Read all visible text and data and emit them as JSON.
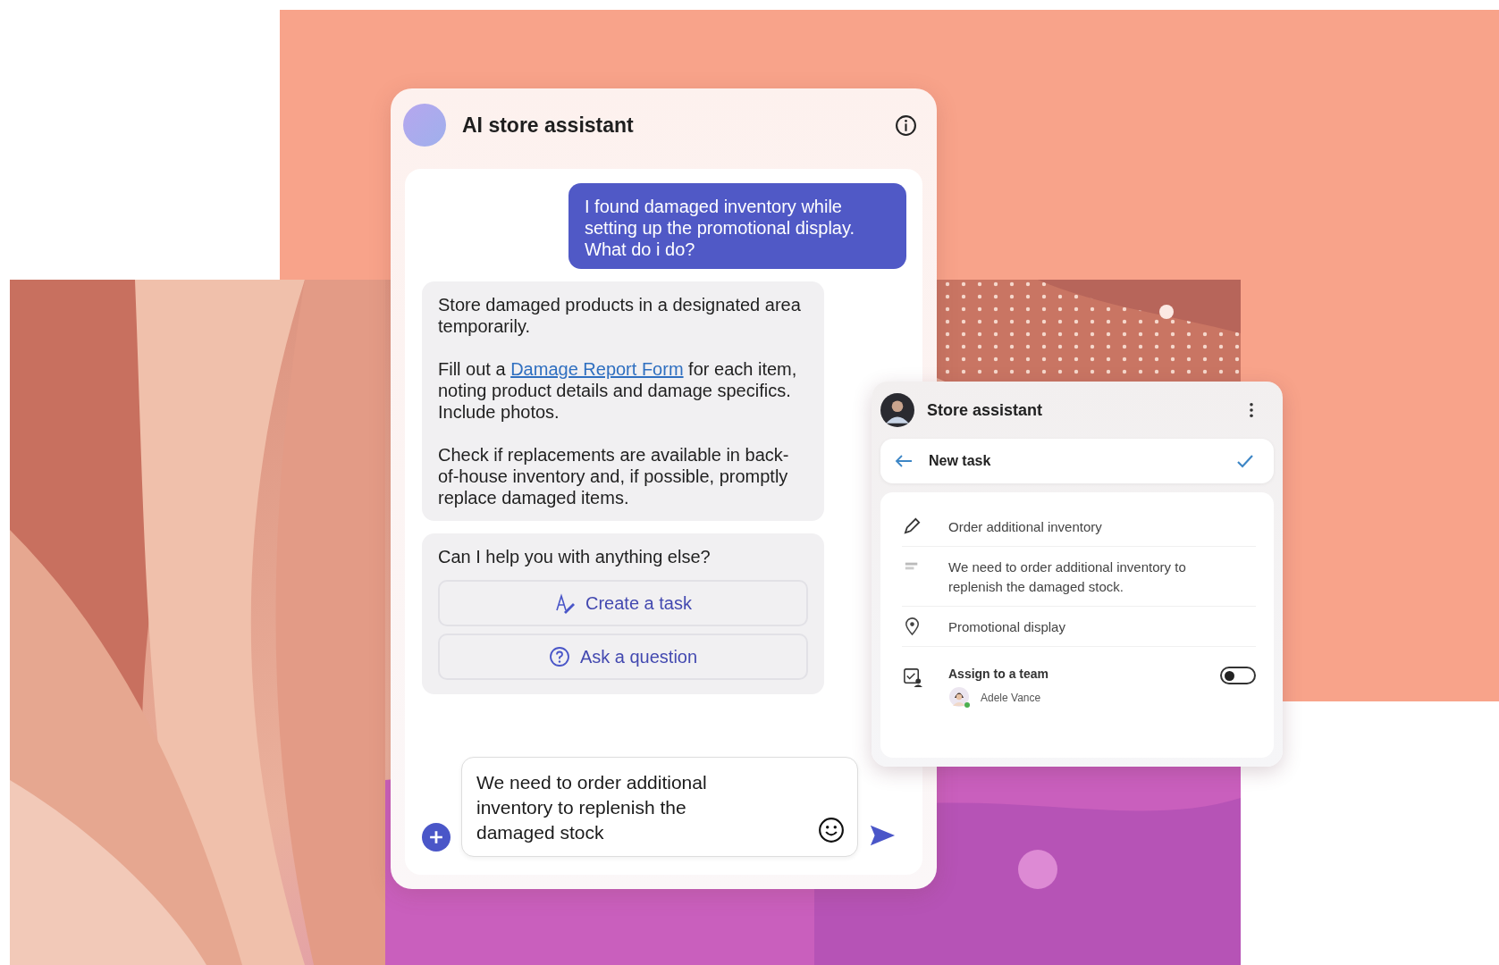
{
  "chat": {
    "title": "AI store assistant",
    "messages": [
      {
        "kind": "user",
        "paragraphs": [
          [
            {
              "kind": "text",
              "text": "I found damaged inventory while setting up the promotional display. What do i do?"
            }
          ]
        ]
      },
      {
        "kind": "bot",
        "paragraphs": [
          [
            {
              "kind": "text",
              "text": "Store damaged products in a designated area temporarily."
            }
          ],
          [
            {
              "kind": "text",
              "text": "Fill out a "
            },
            {
              "kind": "link",
              "text": "Damage Report Form"
            },
            {
              "kind": "text",
              "text": " for each item, noting product details and damage specifics. Include photos."
            }
          ],
          [
            {
              "kind": "text",
              "text": "Check if replacements are available in back-of-house inventory and, if possible, promptly replace damaged items."
            }
          ]
        ]
      }
    ],
    "prompt": {
      "text": "Can I help you with anything else?",
      "actions": [
        {
          "kind": "task",
          "label": "Create a task"
        },
        {
          "kind": "question",
          "label": "Ask a question"
        }
      ]
    },
    "composer": {
      "value": "We need to order additional inventory to replenish the damaged stock"
    }
  },
  "task_panel": {
    "title": "Store assistant",
    "header": {
      "title": "New task"
    },
    "fields": [
      {
        "kind": "title",
        "text": "Order additional inventory"
      },
      {
        "kind": "notes",
        "text": "We need to order additional inventory to replenish the damaged stock."
      },
      {
        "kind": "location",
        "text": "Promotional display"
      },
      {
        "kind": "assign",
        "label": "Assign to a team",
        "on": false,
        "assignee": "Adele Vance"
      }
    ]
  }
}
